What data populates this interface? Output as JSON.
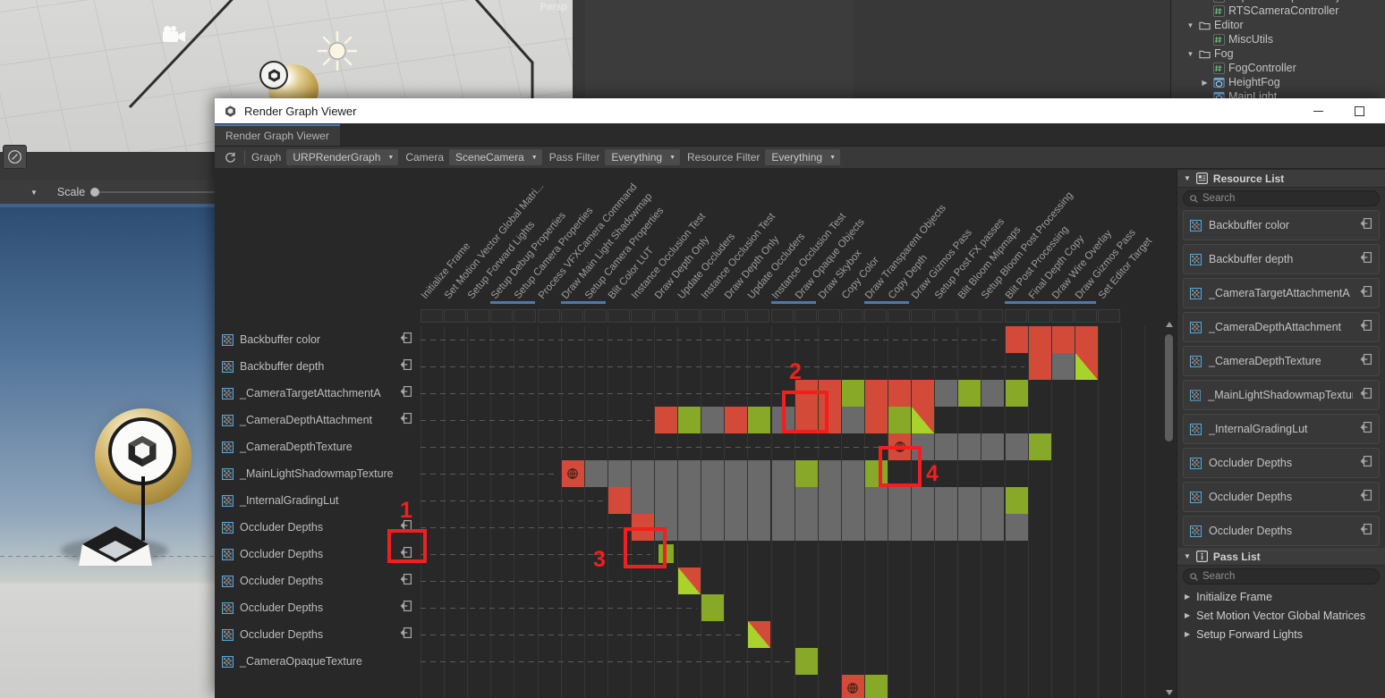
{
  "window": {
    "title": "Render Graph Viewer",
    "icon": "unity-cube-icon",
    "minimize_label": "",
    "maximize_label": "",
    "tab_label": "Render Graph Viewer"
  },
  "toolbar": {
    "refresh_icon": "refresh-icon",
    "graph_label": "Graph",
    "graph_value": "URPRenderGraph",
    "camera_label": "Camera",
    "camera_value": "SceneCamera",
    "pass_filter_label": "Pass Filter",
    "pass_filter_value": "Everything",
    "resource_filter_label": "Resource Filter",
    "resource_filter_value": "Everything"
  },
  "background": {
    "scene_perspective": "Persp",
    "scale_label": "Scale",
    "project_tree": [
      {
        "indent": 2,
        "arrow": "",
        "icon": "cs-script-icon",
        "label": "ExposedScriptableObjectAttributeDrawer"
      },
      {
        "indent": 2,
        "arrow": "",
        "icon": "cs-script-icon",
        "label": "RTSCameraController"
      },
      {
        "indent": 1,
        "arrow": "▼",
        "icon": "folder-icon",
        "label": "Editor"
      },
      {
        "indent": 2,
        "arrow": "",
        "icon": "cs-script-icon",
        "label": "MiscUtils"
      },
      {
        "indent": 1,
        "arrow": "▼",
        "icon": "folder-icon",
        "label": "Fog"
      },
      {
        "indent": 2,
        "arrow": "",
        "icon": "cs-script-icon",
        "label": "FogController"
      },
      {
        "indent": 2,
        "arrow": "▶",
        "icon": "prefab-icon",
        "label": "HeightFog"
      },
      {
        "indent": 2,
        "arrow": "",
        "icon": "prefab-icon",
        "label": "MainLight"
      }
    ]
  },
  "graph": {
    "passes": [
      "Initialize Frame",
      "Set Motion Vector Global Matri...",
      "Setup Forward Lights",
      "Setup Debug Properties",
      "Setup Camera Properties",
      "Process VFXCamera Command",
      "Draw Main Light Shadowmap",
      "Setup Camera Properties",
      "Blit Color LUT",
      "Instance Occlusion Test",
      "Draw Depth Only",
      "Update Occluders",
      "Instance Occlusion Test",
      "Draw Depth Only",
      "Update Occluders",
      "Instance Occlusion Test",
      "Draw Opaque Objects",
      "Draw Skybox",
      "Copy Color",
      "Draw Transparent Objects",
      "Copy Depth",
      "Draw Gizmos Pass",
      "Setup Post FX passes",
      "Blit Bloom Mipmaps",
      "Setup Bloom Post Processing",
      "Blit Post Processing",
      "Final Depth Copy",
      "Draw Wire Overlay",
      "Draw Gizmos Pass",
      "Set Editor Target"
    ],
    "pass_group_underlines": [
      {
        "start": 3,
        "span": 2
      },
      {
        "start": 6,
        "span": 2
      },
      {
        "start": 15,
        "span": 2
      },
      {
        "start": 19,
        "span": 2
      },
      {
        "start": 25,
        "span": 4
      }
    ],
    "resources": [
      {
        "name": "Backbuffer color",
        "icon": "texture-icon",
        "imported": true
      },
      {
        "name": "Backbuffer depth",
        "icon": "texture-icon",
        "imported": true
      },
      {
        "name": "_CameraTargetAttachmentA",
        "icon": "texture-icon",
        "imported": true
      },
      {
        "name": "_CameraDepthAttachment",
        "icon": "texture-icon",
        "imported": true
      },
      {
        "name": "_CameraDepthTexture",
        "icon": "texture-icon",
        "imported": false
      },
      {
        "name": "_MainLightShadowmapTexture",
        "icon": "texture-icon",
        "imported": false
      },
      {
        "name": "_InternalGradingLut",
        "icon": "texture-icon",
        "imported": false
      },
      {
        "name": "Occluder Depths",
        "icon": "texture-icon",
        "imported": true
      },
      {
        "name": "Occluder Depths",
        "icon": "texture-icon",
        "imported": true
      },
      {
        "name": "Occluder Depths",
        "icon": "texture-icon",
        "imported": true
      },
      {
        "name": "Occluder Depths",
        "icon": "texture-icon",
        "imported": true
      },
      {
        "name": "Occluder Depths",
        "icon": "texture-icon",
        "imported": true
      },
      {
        "name": "_CameraOpaqueTexture",
        "icon": "texture-icon",
        "imported": false
      }
    ],
    "colors": {
      "write": "#d34b38",
      "read": "#88a827",
      "readwrite_split": "#a9d22b",
      "inactive": "#6a6a6a",
      "empty": "#282828",
      "accent": "#4a7ab5",
      "annotation": "#f21f1f"
    },
    "usage_rows": [
      {
        "row": 0,
        "cells": [
          {
            "col": 25,
            "type": "write"
          },
          {
            "col": 26,
            "type": "write"
          },
          {
            "col": 27,
            "type": "write"
          },
          {
            "col": 28,
            "type": "write"
          }
        ]
      },
      {
        "row": 1,
        "cells": [
          {
            "col": 26,
            "type": "write"
          },
          {
            "col": 27,
            "type": "inactive"
          },
          {
            "col": 28,
            "type": "split"
          }
        ]
      },
      {
        "row": 2,
        "cells": [
          {
            "col": 16,
            "type": "write"
          },
          {
            "col": 17,
            "type": "write"
          },
          {
            "col": 18,
            "type": "read"
          },
          {
            "col": 19,
            "type": "write"
          },
          {
            "col": 20,
            "type": "write"
          },
          {
            "col": 21,
            "type": "write"
          },
          {
            "col": 22,
            "type": "inactive"
          },
          {
            "col": 23,
            "type": "read"
          },
          {
            "col": 24,
            "type": "inactive"
          },
          {
            "col": 25,
            "type": "read"
          }
        ]
      },
      {
        "row": 3,
        "cells": [
          {
            "col": 10,
            "type": "write"
          },
          {
            "col": 11,
            "type": "read"
          },
          {
            "col": 12,
            "type": "inactive"
          },
          {
            "col": 13,
            "type": "write"
          },
          {
            "col": 14,
            "type": "read"
          },
          {
            "col": 15,
            "type": "inactive"
          },
          {
            "col": 16,
            "type": "write"
          },
          {
            "col": 17,
            "type": "write"
          },
          {
            "col": 18,
            "type": "inactive"
          },
          {
            "col": 19,
            "type": "write"
          },
          {
            "col": 20,
            "type": "read"
          },
          {
            "col": 21,
            "type": "split"
          }
        ]
      },
      {
        "row": 4,
        "cells": [
          {
            "col": 20,
            "type": "write",
            "globe": true
          },
          {
            "col": 21,
            "type": "inactive"
          },
          {
            "col": 22,
            "type": "inactive"
          },
          {
            "col": 23,
            "type": "inactive"
          },
          {
            "col": 24,
            "type": "inactive"
          },
          {
            "col": 25,
            "type": "inactive"
          },
          {
            "col": 26,
            "type": "read"
          }
        ]
      },
      {
        "row": 5,
        "cells": [
          {
            "col": 6,
            "type": "write",
            "globe": true
          },
          {
            "col": 7,
            "type": "inactive"
          },
          {
            "col": 8,
            "type": "inactive"
          },
          {
            "col": 9,
            "type": "inactive"
          },
          {
            "col": 10,
            "type": "inactive"
          },
          {
            "col": 11,
            "type": "inactive"
          },
          {
            "col": 12,
            "type": "inactive"
          },
          {
            "col": 13,
            "type": "inactive"
          },
          {
            "col": 14,
            "type": "inactive"
          },
          {
            "col": 15,
            "type": "inactive"
          },
          {
            "col": 16,
            "type": "read"
          },
          {
            "col": 17,
            "type": "inactive"
          },
          {
            "col": 18,
            "type": "inactive"
          },
          {
            "col": 19,
            "type": "read"
          }
        ]
      },
      {
        "row": 6,
        "cells": [
          {
            "col": 8,
            "type": "write"
          },
          {
            "col": 9,
            "type": "inactive"
          },
          {
            "col": 10,
            "type": "inactive"
          },
          {
            "col": 11,
            "type": "inactive"
          },
          {
            "col": 12,
            "type": "inactive"
          },
          {
            "col": 13,
            "type": "inactive"
          },
          {
            "col": 14,
            "type": "inactive"
          },
          {
            "col": 15,
            "type": "inactive"
          },
          {
            "col": 16,
            "type": "inactive"
          },
          {
            "col": 17,
            "type": "inactive"
          },
          {
            "col": 18,
            "type": "inactive"
          },
          {
            "col": 19,
            "type": "inactive"
          },
          {
            "col": 20,
            "type": "inactive"
          },
          {
            "col": 21,
            "type": "inactive"
          },
          {
            "col": 22,
            "type": "inactive"
          },
          {
            "col": 23,
            "type": "inactive"
          },
          {
            "col": 24,
            "type": "inactive"
          },
          {
            "col": 25,
            "type": "read"
          }
        ]
      },
      {
        "row": 7,
        "cells": [
          {
            "col": 9,
            "type": "write"
          },
          {
            "col": 10,
            "type": "inactive"
          },
          {
            "col": 11,
            "type": "inactive"
          },
          {
            "col": 12,
            "type": "inactive"
          },
          {
            "col": 13,
            "type": "inactive"
          },
          {
            "col": 14,
            "type": "inactive"
          },
          {
            "col": 15,
            "type": "inactive"
          },
          {
            "col": 16,
            "type": "inactive"
          },
          {
            "col": 17,
            "type": "inactive"
          },
          {
            "col": 18,
            "type": "inactive"
          },
          {
            "col": 19,
            "type": "inactive"
          },
          {
            "col": 20,
            "type": "inactive"
          },
          {
            "col": 21,
            "type": "inactive"
          },
          {
            "col": 22,
            "type": "inactive"
          },
          {
            "col": 23,
            "type": "inactive"
          },
          {
            "col": 24,
            "type": "inactive"
          },
          {
            "col": 25,
            "type": "inactive"
          }
        ]
      },
      {
        "row": 8,
        "cells": [
          {
            "col": 10,
            "type": "read",
            "small": true
          }
        ]
      },
      {
        "row": 9,
        "cells": [
          {
            "col": 11,
            "type": "split"
          }
        ]
      },
      {
        "row": 10,
        "cells": [
          {
            "col": 12,
            "type": "read"
          }
        ]
      },
      {
        "row": 11,
        "cells": [
          {
            "col": 14,
            "type": "split"
          }
        ]
      },
      {
        "row": 12,
        "cells": [
          {
            "col": 16,
            "type": "read"
          }
        ]
      },
      {
        "row": 13,
        "cells": [
          {
            "col": 18,
            "type": "write",
            "globe": true
          },
          {
            "col": 19,
            "type": "read"
          }
        ]
      }
    ],
    "annotations": [
      {
        "id": "1",
        "label": "1"
      },
      {
        "id": "2",
        "label": "2"
      },
      {
        "id": "3",
        "label": "3"
      },
      {
        "id": "4",
        "label": "4"
      }
    ]
  },
  "side": {
    "resource_list": {
      "title": "Resource List",
      "icon": "resource-list-icon",
      "fold": "▼",
      "search_placeholder": "Search",
      "search_icon": "search-icon",
      "items": [
        {
          "name": "Backbuffer color",
          "imported": true
        },
        {
          "name": "Backbuffer depth",
          "imported": true
        },
        {
          "name": "_CameraTargetAttachmentA",
          "imported": true
        },
        {
          "name": "_CameraDepthAttachment",
          "imported": true
        },
        {
          "name": "_CameraDepthTexture",
          "imported": true
        },
        {
          "name": "_MainLightShadowmapTexture",
          "imported": true
        },
        {
          "name": "_InternalGradingLut",
          "imported": true
        },
        {
          "name": "Occluder Depths",
          "imported": true
        },
        {
          "name": "Occluder Depths",
          "imported": true
        },
        {
          "name": "Occluder Depths",
          "imported": true
        }
      ]
    },
    "pass_list": {
      "title": "Pass List",
      "icon": "info-icon",
      "fold": "▼",
      "search_placeholder": "Search",
      "search_icon": "search-icon",
      "items": [
        {
          "name": "Initialize Frame",
          "arrow": "▶"
        },
        {
          "name": "Set Motion Vector Global Matrices",
          "arrow": "▶"
        },
        {
          "name": "Setup Forward Lights",
          "arrow": "▶"
        }
      ]
    }
  }
}
